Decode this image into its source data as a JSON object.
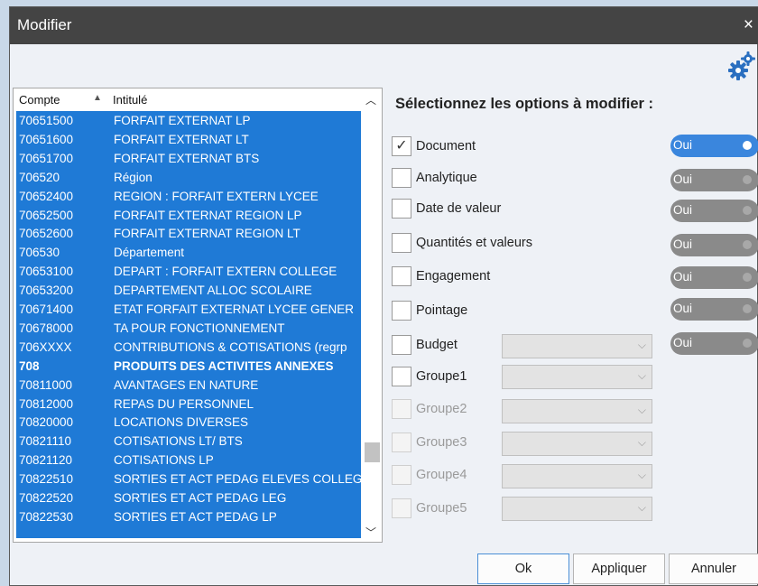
{
  "window": {
    "title": "Modifier",
    "close_glyph": "×"
  },
  "list": {
    "headers": {
      "compte": "Compte",
      "intitule": "Intitulé"
    },
    "rows": [
      {
        "compte": "70651500",
        "intitule": "FORFAIT EXTERNAT LP",
        "bold": false
      },
      {
        "compte": "70651600",
        "intitule": "FORFAIT EXTERNAT LT",
        "bold": false
      },
      {
        "compte": "70651700",
        "intitule": "FORFAIT EXTERNAT BTS",
        "bold": false
      },
      {
        "compte": "706520",
        "intitule": "Région",
        "bold": false
      },
      {
        "compte": "70652400",
        "intitule": "REGION : FORFAIT EXTERN LYCEE",
        "bold": false
      },
      {
        "compte": "70652500",
        "intitule": "FORFAIT EXTERNAT REGION LP",
        "bold": false
      },
      {
        "compte": "70652600",
        "intitule": "FORFAIT EXTERNAT REGION LT",
        "bold": false
      },
      {
        "compte": "706530",
        "intitule": "Département",
        "bold": false
      },
      {
        "compte": "70653100",
        "intitule": "DEPART : FORFAIT EXTERN COLLEGE",
        "bold": false
      },
      {
        "compte": "70653200",
        "intitule": "DEPARTEMENT ALLOC SCOLAIRE",
        "bold": false
      },
      {
        "compte": "70671400",
        "intitule": "ETAT FORFAIT EXTERNAT LYCEE GENER",
        "bold": false
      },
      {
        "compte": "70678000",
        "intitule": "TA POUR FONCTIONNEMENT",
        "bold": false
      },
      {
        "compte": "706XXXX",
        "intitule": "CONTRIBUTIONS & COTISATIONS (regrp",
        "bold": false
      },
      {
        "compte": "708",
        "intitule": "PRODUITS DES ACTIVITES ANNEXES",
        "bold": true
      },
      {
        "compte": "70811000",
        "intitule": "AVANTAGES EN NATURE",
        "bold": false
      },
      {
        "compte": "70812000",
        "intitule": "REPAS DU PERSONNEL",
        "bold": false
      },
      {
        "compte": "70820000",
        "intitule": "LOCATIONS DIVERSES",
        "bold": false
      },
      {
        "compte": "70821110",
        "intitule": "COTISATIONS LT/ BTS",
        "bold": false
      },
      {
        "compte": "70821120",
        "intitule": "COTISATIONS LP",
        "bold": false
      },
      {
        "compte": "70822510",
        "intitule": "SORTIES ET ACT PEDAG ELEVES COLLEG",
        "bold": false
      },
      {
        "compte": "70822520",
        "intitule": "SORTIES ET ACT PEDAG LEG",
        "bold": false
      },
      {
        "compte": "70822530",
        "intitule": "SORTIES ET ACT PEDAG LP",
        "bold": false
      }
    ]
  },
  "options": {
    "title": "Sélectionnez les options à modifier :",
    "items": [
      {
        "label": "Document",
        "checked": true,
        "enabled": true,
        "toggle": "Oui",
        "toggle_on": true
      },
      {
        "label": "Analytique",
        "checked": false,
        "enabled": true,
        "toggle": "Oui",
        "toggle_on": false
      },
      {
        "label": "Date de valeur",
        "checked": false,
        "enabled": true,
        "toggle": "Oui",
        "toggle_on": false
      },
      {
        "label": "Quantités et valeurs",
        "checked": false,
        "enabled": true,
        "toggle": "Oui",
        "toggle_on": false
      },
      {
        "label": "Engagement",
        "checked": false,
        "enabled": true,
        "toggle": "Oui",
        "toggle_on": false
      },
      {
        "label": "Pointage",
        "checked": false,
        "enabled": true,
        "toggle": "Oui",
        "toggle_on": false
      },
      {
        "label": "Budget",
        "checked": false,
        "enabled": true,
        "toggle": "Oui",
        "toggle_on": false,
        "combo": ""
      },
      {
        "label": "Groupe1",
        "checked": false,
        "enabled": true,
        "combo": ""
      },
      {
        "label": "Groupe2",
        "checked": false,
        "enabled": false,
        "combo": ""
      },
      {
        "label": "Groupe3",
        "checked": false,
        "enabled": false,
        "combo": ""
      },
      {
        "label": "Groupe4",
        "checked": false,
        "enabled": false,
        "combo": ""
      },
      {
        "label": "Groupe5",
        "checked": false,
        "enabled": false,
        "combo": ""
      }
    ]
  },
  "buttons": {
    "ok": "Ok",
    "apply": "Appliquer",
    "cancel": "Annuler"
  },
  "icons": {
    "gear": "gears-icon",
    "check": "✓",
    "chevron": "⌵"
  },
  "colors": {
    "selection": "#1f7ad6",
    "toggle_on": "#3a86dd",
    "toggle_off": "#8a8a8a",
    "titlebar": "#444444"
  }
}
